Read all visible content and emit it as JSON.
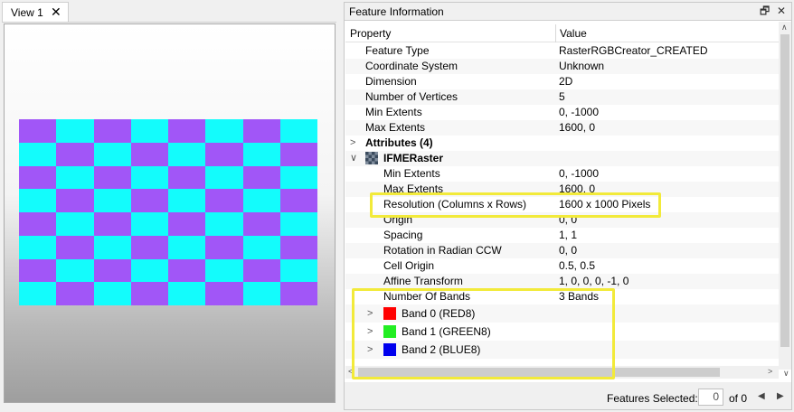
{
  "view": {
    "tab_label": "View 1",
    "close_glyph": "✕"
  },
  "checker": {
    "colors": [
      "#a156f7",
      "#13fcfc"
    ],
    "cols": 8,
    "rows": 8
  },
  "panel": {
    "title": "Feature Information",
    "restore_glyph": "🗗",
    "close_glyph": "✕"
  },
  "table": {
    "col_property": "Property",
    "col_value": "Value",
    "rows": [
      {
        "prop": "Feature Type",
        "val": "RasterRGBCreator_CREATED",
        "indent": 1
      },
      {
        "prop": "Coordinate System",
        "val": "Unknown",
        "indent": 1
      },
      {
        "prop": "Dimension",
        "val": "2D",
        "indent": 1
      },
      {
        "prop": "Number of Vertices",
        "val": "5",
        "indent": 1
      },
      {
        "prop": "Min Extents",
        "val": "0, -1000",
        "indent": 1
      },
      {
        "prop": "Max Extents",
        "val": "1600, 0",
        "indent": 1
      },
      {
        "prop": "Attributes (4)",
        "val": "",
        "indent": 1,
        "bold": true,
        "expander": "collapsed"
      },
      {
        "prop": "IFMERaster",
        "val": "",
        "indent": 1,
        "bold": true,
        "expander": "expanded",
        "icon": "raster-icon"
      },
      {
        "prop": "Min Extents",
        "val": "0, -1000",
        "indent": 2
      },
      {
        "prop": "Max Extents",
        "val": "1600, 0",
        "indent": 2
      },
      {
        "prop": "Resolution (Columns x Rows)",
        "val": "1600 x 1000 Pixels",
        "indent": 2
      },
      {
        "prop": "Origin",
        "val": "0, 0",
        "indent": 2
      },
      {
        "prop": "Spacing",
        "val": "1, 1",
        "indent": 2
      },
      {
        "prop": "Rotation in Radian CCW",
        "val": "0, 0",
        "indent": 2
      },
      {
        "prop": "Cell Origin",
        "val": "0.5, 0.5",
        "indent": 2
      },
      {
        "prop": "Affine Transform",
        "val": "1, 0, 0, 0, -1, 0",
        "indent": 2
      },
      {
        "prop": "Number Of Bands",
        "val": "3 Bands",
        "indent": 2
      },
      {
        "prop": "Band 0 (RED8)",
        "val": "",
        "indent": 2,
        "expander": "collapsed",
        "swatch": "#ff0000",
        "tall": true
      },
      {
        "prop": "Band 1 (GREEN8)",
        "val": "",
        "indent": 2,
        "expander": "collapsed",
        "swatch": "#22ee22",
        "tall": true
      },
      {
        "prop": "Band 2 (BLUE8)",
        "val": "",
        "indent": 2,
        "expander": "collapsed",
        "swatch": "#0000ee",
        "tall": true
      }
    ]
  },
  "status": {
    "features_selected_label": "Features Selected:",
    "selected_count": "0",
    "of_label": "of 0"
  },
  "highlight_color": "#f2ea3a"
}
